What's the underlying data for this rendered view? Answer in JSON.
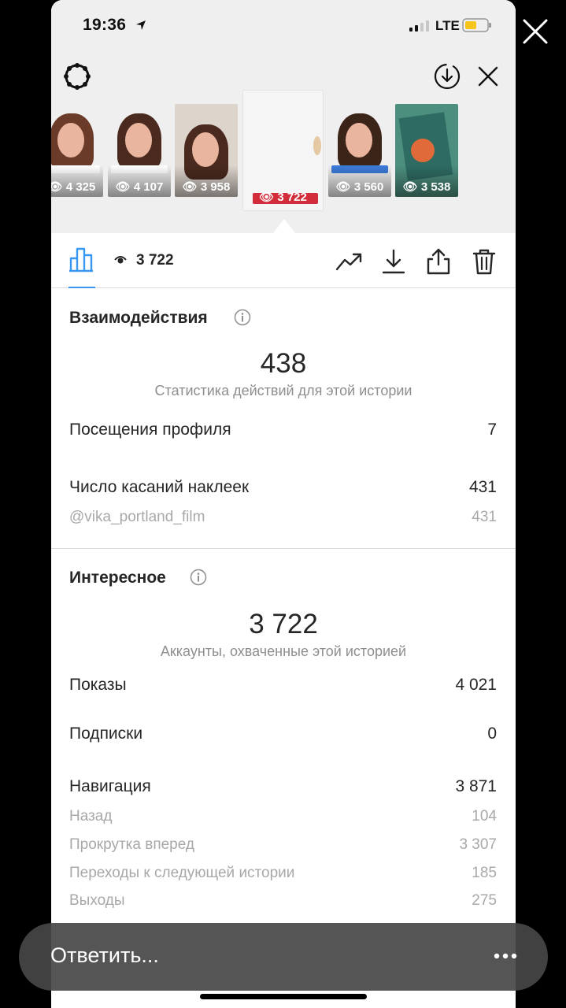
{
  "status": {
    "time": "19:36",
    "network": "LTE"
  },
  "stories": [
    {
      "views": "4 325",
      "bg": "#c48f7e"
    },
    {
      "views": "4 107",
      "bg": "#7a5a48"
    },
    {
      "views": "3 958",
      "bg": "#d8cfc8"
    },
    {
      "views": "3 722",
      "bg": "#f5f5f5"
    },
    {
      "views": "3 560",
      "bg": "#b8a59a"
    },
    {
      "views": "3 538",
      "bg": "#5b8f80"
    }
  ],
  "tabbar": {
    "views": "3 722"
  },
  "interactions": {
    "title": "Взаимодействия",
    "total": "438",
    "subtitle": "Статистика действий для этой истории",
    "rows": [
      {
        "label": "Посещения профиля",
        "value": "7"
      },
      {
        "label": "Число касаний наклеек",
        "value": "431"
      }
    ],
    "sub_rows": [
      {
        "label": "@vika_portland_film",
        "value": "431"
      }
    ]
  },
  "discovery": {
    "title": "Интересное",
    "total": "3 722",
    "subtitle": "Аккаунты, охваченные этой историей",
    "rows": [
      {
        "label": "Показы",
        "value": "4 021"
      },
      {
        "label": "Подписки",
        "value": "0"
      },
      {
        "label": "Навигация",
        "value": "3 871"
      }
    ],
    "sub_rows": [
      {
        "label": "Назад",
        "value": "104"
      },
      {
        "label": "Прокрутка вперед",
        "value": "3 307"
      },
      {
        "label": "Переходы к следующей истории",
        "value": "185"
      },
      {
        "label": "Выходы",
        "value": "275"
      }
    ]
  },
  "reply": {
    "placeholder": "Ответить..."
  },
  "colors": {
    "accent": "#3897f0",
    "muted": "#8e8e8e",
    "reply_bar": "#464646"
  }
}
